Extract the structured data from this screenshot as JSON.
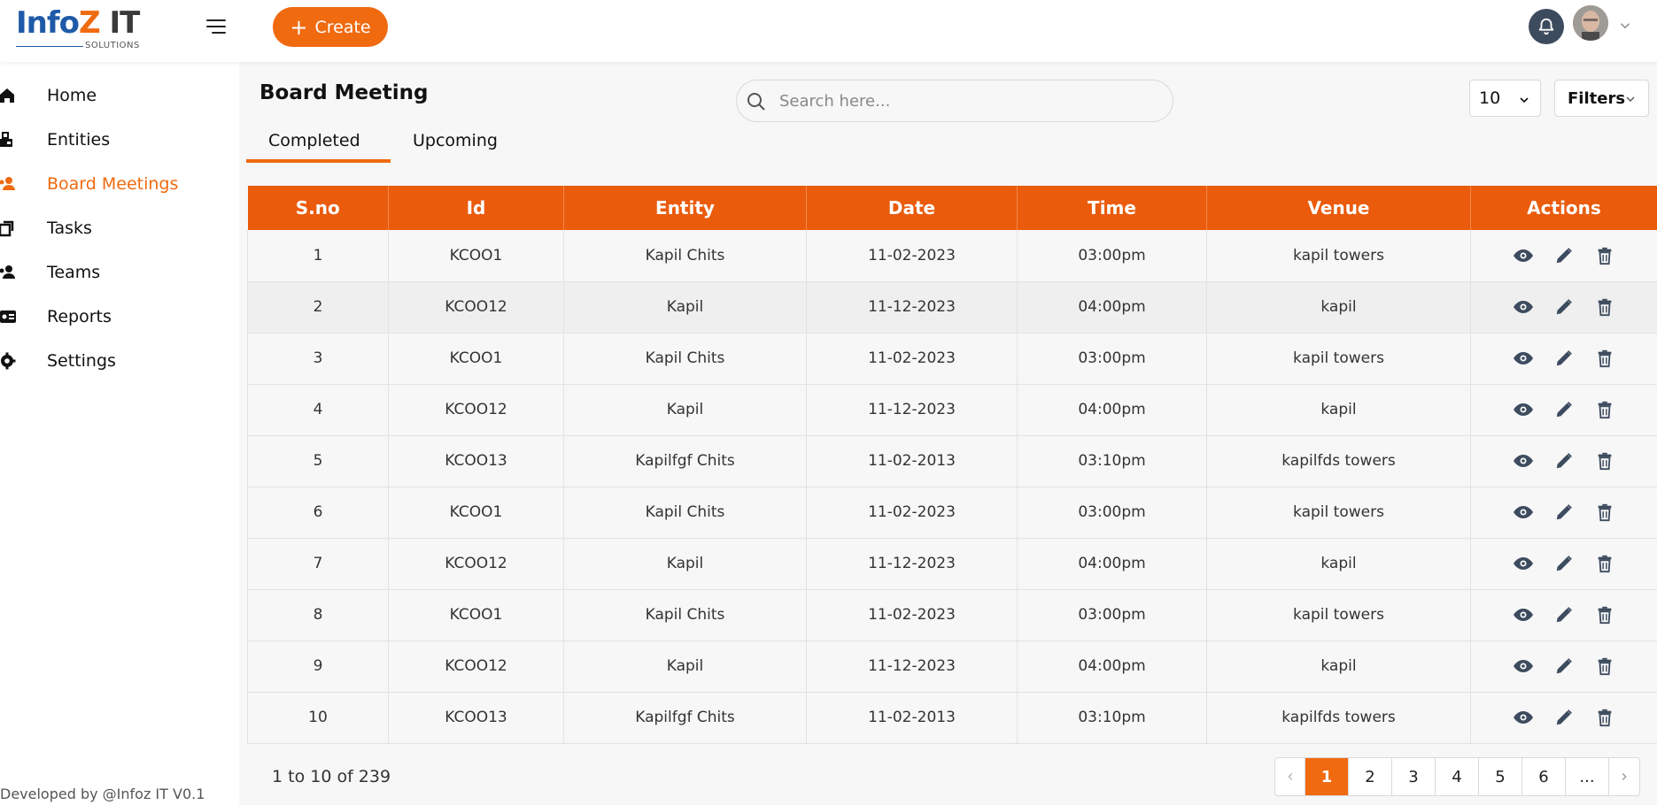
{
  "brand": {
    "logo_part1": "Info",
    "logo_part2": "Z",
    "logo_part3": " IT",
    "logo_sub": "SOLUTIONS",
    "accent_color": "#f06a10",
    "header_color": "#ea5b0c"
  },
  "topbar": {
    "create_label": "Create"
  },
  "sidebar": {
    "items": [
      {
        "label": "Home",
        "icon": "home-icon",
        "active": false
      },
      {
        "label": "Entities",
        "icon": "entities-icon",
        "active": false
      },
      {
        "label": "Board Meetings",
        "icon": "users-icon",
        "active": true
      },
      {
        "label": "Tasks",
        "icon": "tasks-icon",
        "active": false
      },
      {
        "label": "Teams",
        "icon": "team-icon",
        "active": false
      },
      {
        "label": "Reports",
        "icon": "report-icon",
        "active": false
      },
      {
        "label": "Settings",
        "icon": "gear-icon",
        "active": false
      }
    ],
    "footer": "Developed by @Infoz IT V0.1"
  },
  "main": {
    "title": "Board Meeting",
    "tabs": [
      {
        "label": "Completed",
        "active": true
      },
      {
        "label": "Upcoming",
        "active": false
      }
    ],
    "search_placeholder": "Search here...",
    "page_size": "10",
    "filters_label": "Filters"
  },
  "table": {
    "columns": [
      "S.no",
      "Id",
      "Entity",
      "Date",
      "Time",
      "Venue",
      "Actions"
    ],
    "rows": [
      [
        "1",
        "KCOO1",
        "Kapil Chits",
        "11-02-2023",
        "03:00pm",
        "kapil towers"
      ],
      [
        "2",
        "KCOO12",
        "Kapil",
        "11-12-2023",
        "04:00pm",
        "kapil"
      ],
      [
        "3",
        "KCOO1",
        "Kapil Chits",
        "11-02-2023",
        "03:00pm",
        "kapil towers"
      ],
      [
        "4",
        "KCOO12",
        "Kapil",
        "11-12-2023",
        "04:00pm",
        "kapil"
      ],
      [
        "5",
        "KCOO13",
        "Kapilfgf Chits",
        "11-02-2013",
        "03:10pm",
        "kapilfds towers"
      ],
      [
        "6",
        "KCOO1",
        "Kapil Chits",
        "11-02-2023",
        "03:00pm",
        "kapil towers"
      ],
      [
        "7",
        "KCOO12",
        "Kapil",
        "11-12-2023",
        "04:00pm",
        "kapil"
      ],
      [
        "8",
        "KCOO1",
        "Kapil Chits",
        "11-02-2023",
        "03:00pm",
        "kapil towers"
      ],
      [
        "9",
        "KCOO12",
        "Kapil",
        "11-12-2023",
        "04:00pm",
        "kapil"
      ],
      [
        "10",
        "KCOO13",
        "Kapilfgf Chits",
        "11-02-2013",
        "03:10pm",
        "kapilfds towers"
      ]
    ]
  },
  "pagination": {
    "range_text": "1 to 10 of 239",
    "pages": [
      "1",
      "2",
      "3",
      "4",
      "5",
      "6",
      "..."
    ],
    "current_page": "1"
  }
}
